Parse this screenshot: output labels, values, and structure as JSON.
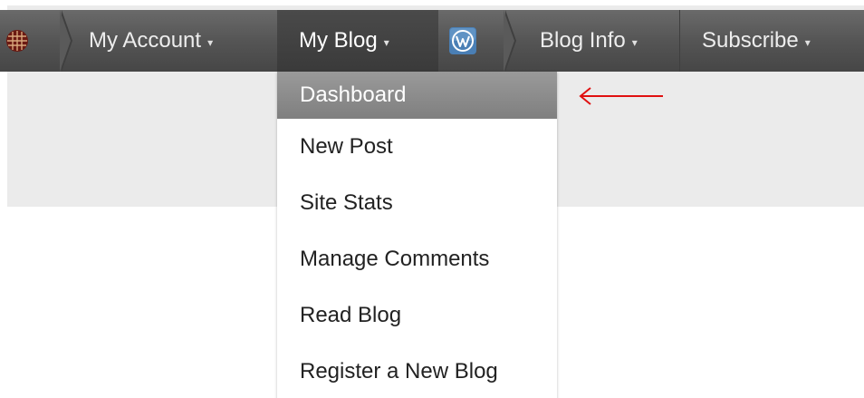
{
  "adminbar": {
    "logo_icon": "grid-logo-icon",
    "items": [
      {
        "label": "My Account",
        "caret": "▾"
      },
      {
        "label": "My Blog",
        "caret": "▾"
      },
      {
        "label": "Blog Info",
        "caret": "▾"
      },
      {
        "label": "Subscribe",
        "caret": "▾"
      }
    ],
    "wp_icon": "wordpress-icon"
  },
  "my_blog_menu": {
    "items": [
      {
        "label": "Dashboard",
        "active": true
      },
      {
        "label": "New Post"
      },
      {
        "label": "Site Stats"
      },
      {
        "label": "Manage Comments"
      },
      {
        "label": "Read Blog"
      },
      {
        "label": "Register a New Blog"
      }
    ]
  },
  "annotation": {
    "icon": "red-left-arrow-icon",
    "color": "#e01010"
  },
  "colors": {
    "bar": "#555555",
    "active_bar_item": "#3a3a3a",
    "menu_highlight": "#8c8c8c",
    "page_gray": "#ebebeb"
  }
}
